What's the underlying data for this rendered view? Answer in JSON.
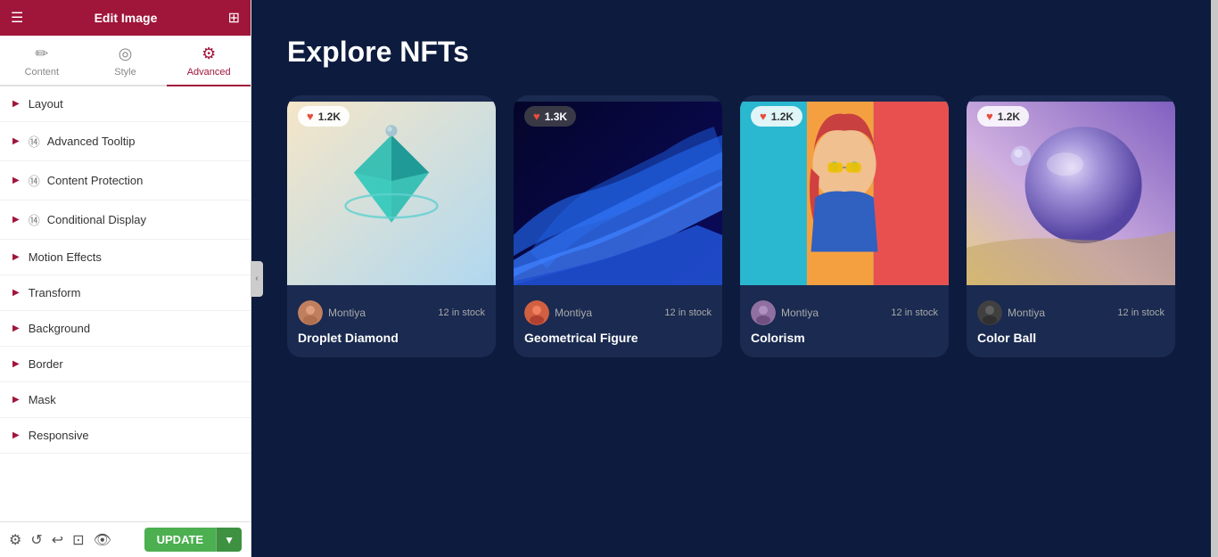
{
  "header": {
    "title": "Edit Image",
    "grid_icon": "⊞",
    "menu_icon": "☰"
  },
  "tabs": [
    {
      "id": "content",
      "label": "Content",
      "icon": "✏️",
      "active": false
    },
    {
      "id": "style",
      "label": "Style",
      "icon": "🎨",
      "active": false
    },
    {
      "id": "advanced",
      "label": "Advanced",
      "icon": "⚙",
      "active": true
    }
  ],
  "sidebar_items": [
    {
      "id": "layout",
      "label": "Layout",
      "has_icon": false
    },
    {
      "id": "advanced-tooltip",
      "label": "Advanced Tooltip",
      "has_icon": true
    },
    {
      "id": "content-protection",
      "label": "Content Protection",
      "has_icon": true
    },
    {
      "id": "conditional-display",
      "label": "Conditional Display",
      "has_icon": true
    },
    {
      "id": "motion-effects",
      "label": "Motion Effects",
      "has_icon": false
    },
    {
      "id": "transform",
      "label": "Transform",
      "has_icon": false
    },
    {
      "id": "background",
      "label": "Background",
      "has_icon": false
    },
    {
      "id": "border",
      "label": "Border",
      "has_icon": false
    },
    {
      "id": "mask",
      "label": "Mask",
      "has_icon": false
    },
    {
      "id": "responsive",
      "label": "Responsive",
      "has_icon": false
    }
  ],
  "bottom_bar": {
    "update_label": "UPDATE",
    "arrow_label": "▼"
  },
  "main": {
    "title": "Explore NFTs",
    "cards": [
      {
        "id": "card-1",
        "title": "Droplet Diamond",
        "author": "Montiya",
        "stock": "12 in stock",
        "likes": "1.2K",
        "bg_color_start": "#f5e6c8",
        "bg_color_end": "#b0d8f0",
        "image_type": "crystal"
      },
      {
        "id": "card-2",
        "title": "Geometrical Figure",
        "author": "Montiya",
        "stock": "12 in stock",
        "likes": "1.3K",
        "bg_color_start": "#0a0a40",
        "bg_color_end": "#1a1a80",
        "image_type": "wave"
      },
      {
        "id": "card-3",
        "title": "Colorism",
        "author": "Montiya",
        "stock": "12 in stock",
        "likes": "1.2K",
        "bg_color_start": "#2ab8c8",
        "bg_color_end": "#f0a040",
        "image_type": "portrait"
      },
      {
        "id": "card-4",
        "title": "Color Ball",
        "author": "Montiya",
        "stock": "12 in stock",
        "likes": "1.2K",
        "bg_color_start": "#d0c0f0",
        "bg_color_end": "#f0e0a0",
        "image_type": "planet"
      }
    ]
  }
}
